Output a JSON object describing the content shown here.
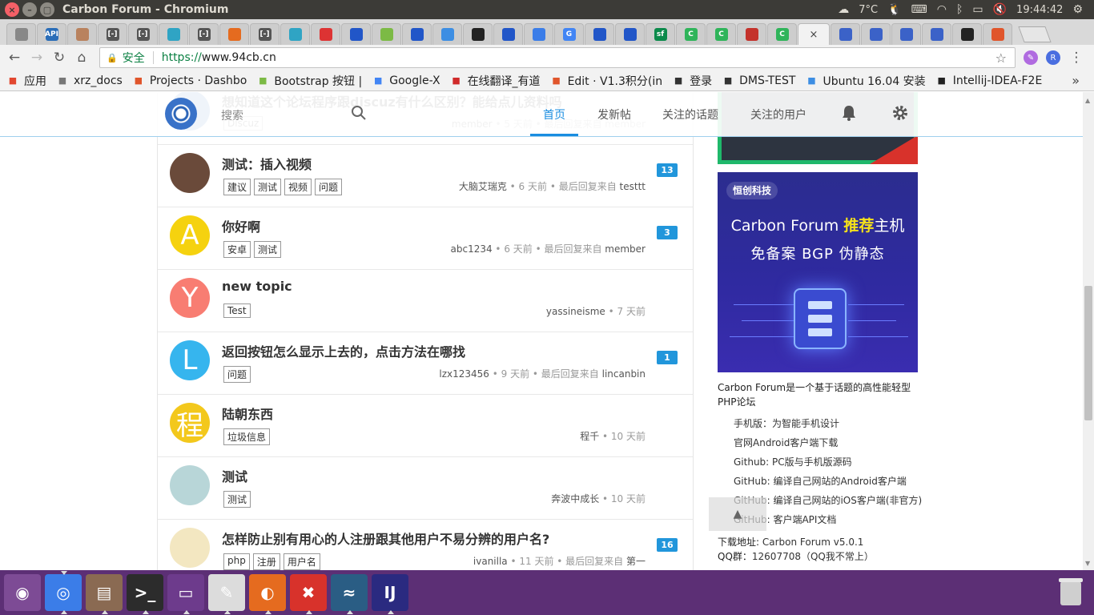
{
  "window": {
    "title": "Carbon Forum - Chromium"
  },
  "tray": {
    "weather": "7°C",
    "time": "19:44:42"
  },
  "tabs": [
    {
      "icon": "page-icon",
      "color": "#888"
    },
    {
      "icon": "api-icon",
      "color": "#2a6db8",
      "text": "API"
    },
    {
      "icon": "avatar-icon",
      "color": "#b9825e"
    },
    {
      "icon": "bracket-icon",
      "color": "#555",
      "text": "[-]"
    },
    {
      "icon": "bracket-icon",
      "color": "#555",
      "text": "[-]"
    },
    {
      "icon": "grid-icon",
      "color": "#2fa4c4"
    },
    {
      "icon": "bracket-icon",
      "color": "#555",
      "text": "[-]"
    },
    {
      "icon": "firefox-icon",
      "color": "#e56b1f"
    },
    {
      "icon": "bracket-icon",
      "color": "#555",
      "text": "[-]"
    },
    {
      "icon": "grid-icon",
      "color": "#2fa4c4"
    },
    {
      "icon": "cn-icon",
      "color": "#d33"
    },
    {
      "icon": "paw-icon",
      "color": "#2156c8"
    },
    {
      "icon": "code-icon",
      "color": "#7cba45"
    },
    {
      "icon": "paw-icon",
      "color": "#2156c8"
    },
    {
      "icon": "globe-icon",
      "color": "#3d8ee3"
    },
    {
      "icon": "github-icon",
      "color": "#222"
    },
    {
      "icon": "paw-icon",
      "color": "#2156c8"
    },
    {
      "icon": "arrow-icon",
      "color": "#3b7de8"
    },
    {
      "icon": "google-icon",
      "color": "#4285f4",
      "text": "G"
    },
    {
      "icon": "paw-icon",
      "color": "#2156c8"
    },
    {
      "icon": "paw-icon",
      "color": "#2156c8"
    },
    {
      "icon": "sf-icon",
      "color": "#0b8a4b",
      "text": "sf"
    },
    {
      "icon": "c-icon",
      "color": "#2fb45a",
      "text": "C"
    },
    {
      "icon": "c-icon",
      "color": "#2fb45a",
      "text": "C"
    },
    {
      "icon": "maze-icon",
      "color": "#c4322b"
    },
    {
      "icon": "c-icon",
      "color": "#2fb45a",
      "text": "C"
    },
    {
      "icon": "close-icon",
      "color": "#444",
      "active": true
    },
    {
      "icon": "chromium-icon",
      "color": "#3b62c8"
    },
    {
      "icon": "chromium-icon",
      "color": "#3b62c8"
    },
    {
      "icon": "chromium-icon",
      "color": "#3b62c8"
    },
    {
      "icon": "chromium-icon",
      "color": "#3b62c8"
    },
    {
      "icon": "github-icon",
      "color": "#222"
    },
    {
      "icon": "gitlab-icon",
      "color": "#e0552b"
    }
  ],
  "toolbar": {
    "secure_label": "安全",
    "url_scheme": "https://",
    "url_host": "www.94cb.cn"
  },
  "bookmarks": [
    {
      "label": "应用",
      "icon": "apps-icon",
      "color": "#e2472f"
    },
    {
      "label": "xrz_docs",
      "icon": "page-icon",
      "color": "#777"
    },
    {
      "label": "Projects · Dashbo",
      "icon": "gitlab-icon",
      "color": "#e0552b"
    },
    {
      "label": "Bootstrap 按钮 |",
      "icon": "code-icon",
      "color": "#7cba45"
    },
    {
      "label": "Google-X",
      "icon": "google-icon",
      "color": "#4285f4"
    },
    {
      "label": "在线翻译_有道",
      "icon": "youdao-icon",
      "color": "#d02a2a"
    },
    {
      "label": "Edit · V1.3积分(in",
      "icon": "gitlab-icon",
      "color": "#e0552b"
    },
    {
      "label": "登录",
      "icon": "bracket-icon",
      "color": "#333"
    },
    {
      "label": "DMS-TEST",
      "icon": "bracket-icon",
      "color": "#333"
    },
    {
      "label": "Ubuntu 16.04 安装",
      "icon": "globe-icon",
      "color": "#3d8ee3"
    },
    {
      "label": "Intellij-IDEA-F2E",
      "icon": "github-icon",
      "color": "#222"
    }
  ],
  "header": {
    "search_placeholder": "搜索",
    "nav": [
      "首页",
      "发新帖",
      "关注的话题",
      "关注的用户"
    ]
  },
  "topics": [
    {
      "title": "想知道这个论坛程序跟discuz有什么区别？能给点儿资料吗",
      "tags": [
        "Discuz"
      ],
      "user": "member",
      "meta_rest": " • 5 天前 • 最后回复来自 member",
      "badge": "",
      "avatar_color": "#3a70c2",
      "avatar_letter": ""
    },
    {
      "title": "测试：插入视频",
      "tags": [
        "建议",
        "测试",
        "视频",
        "问题"
      ],
      "user": "大脑艾瑞克",
      "meta_rest": " • 6 天前 • 最后回复来自 ",
      "last_user": "testtt",
      "badge": "13",
      "avatar_color": "#6a4a3a",
      "avatar_letter": ""
    },
    {
      "title": "你好啊",
      "tags": [
        "安卓",
        "测试"
      ],
      "user": "abc1234",
      "meta_rest": " • 6 天前 • 最后回复来自 ",
      "last_user": "member",
      "badge": "3",
      "avatar_color": "#f5d20f",
      "avatar_letter": "A"
    },
    {
      "title": "new topic",
      "tags": [
        "Test"
      ],
      "user": "yassineisme",
      "meta_rest": " • 7 天前",
      "last_user": "",
      "badge": "",
      "avatar_color": "#f87d72",
      "avatar_letter": "Y"
    },
    {
      "title": "返回按钮怎么显示上去的，点击方法在哪找",
      "tags": [
        "问题"
      ],
      "user": "lzx123456",
      "meta_rest": " • 9 天前 • 最后回复来自 ",
      "last_user": "lincanbin",
      "badge": "1",
      "avatar_color": "#36b5ee",
      "avatar_letter": "L"
    },
    {
      "title": "陆朝东西",
      "tags": [
        "垃圾信息"
      ],
      "user": "程千",
      "meta_rest": " • 10 天前",
      "last_user": "",
      "badge": "",
      "avatar_color": "#f3c81c",
      "avatar_letter": "程"
    },
    {
      "title": "测试",
      "tags": [
        "测试"
      ],
      "user": "奔波中成长",
      "meta_rest": " • 10 天前",
      "last_user": "",
      "badge": "",
      "avatar_color": "#b8d6d8",
      "avatar_letter": ""
    },
    {
      "title": "怎样防止别有用心的人注册跟其他用户不易分辨的用户名?",
      "tags": [
        "php",
        "注册",
        "用户名"
      ],
      "user": "ivanilla",
      "meta_rest": " • 11 天前 • 最后回复来自 ",
      "last_user": "第一",
      "badge": "16",
      "avatar_color": "#f3e7c1",
      "avatar_letter": ""
    }
  ],
  "sidebar": {
    "ad2_brand": "恒创科技",
    "ad2_line1_a": "Carbon Forum ",
    "ad2_line1_b": "推荐",
    "ad2_line1_c": "主机",
    "ad2_line2": "免备案 BGP 伪静态",
    "desc": "Carbon Forum是一个基于话题的高性能轻型PHP论坛",
    "links": [
      "手机版：为智能手机设计",
      "官网Android客户端下载",
      "Github: PC版与手机版源码",
      "GitHub: 编译自己网站的Android客户端",
      "GitHub: 编译自己网站的iOS客户端(非官方)",
      "GitHub: 客户端API文档"
    ],
    "download_label": "下载地址: ",
    "download_value": "Carbon Forum v5.0.1",
    "qq_label": "QQ群：",
    "qq_value": "12607708（QQ我不常上）"
  },
  "dock": [
    {
      "icon": "ubuntu-icon",
      "color": "#7d4b95"
    },
    {
      "icon": "chromium-icon",
      "color": "#3b7de8",
      "active": true
    },
    {
      "icon": "files-icon",
      "color": "#8a6a52"
    },
    {
      "icon": "terminal-icon",
      "color": "#2c2c2c"
    },
    {
      "icon": "window-icon",
      "color": "#6d3b8c"
    },
    {
      "icon": "text-editor-icon",
      "color": "#dcdcdc"
    },
    {
      "icon": "firefox-icon",
      "color": "#e56b1f"
    },
    {
      "icon": "xmind-icon",
      "color": "#d8322b"
    },
    {
      "icon": "mysql-workbench-icon",
      "color": "#2a5d84"
    },
    {
      "icon": "intellij-icon",
      "color": "#2a2a80"
    }
  ]
}
